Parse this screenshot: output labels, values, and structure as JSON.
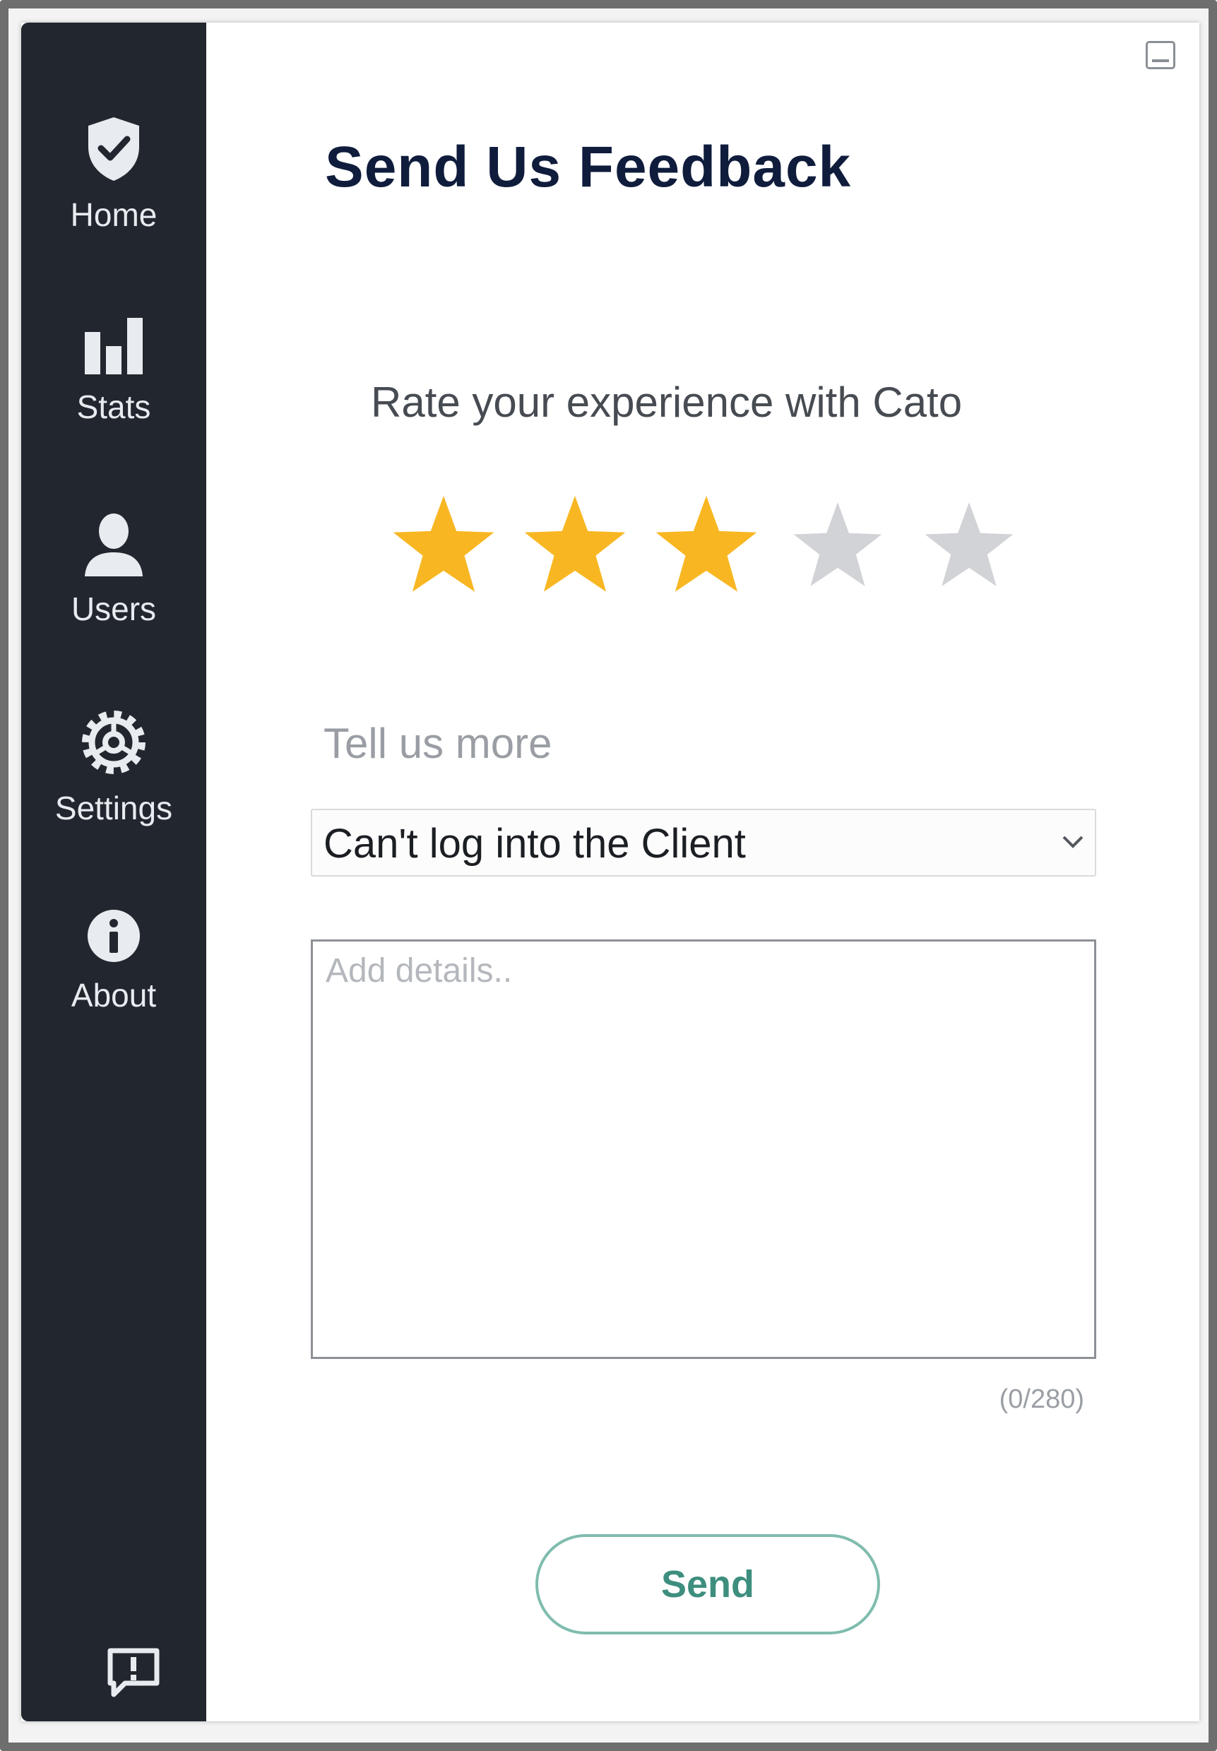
{
  "sidebar": {
    "items": [
      {
        "label": "Home",
        "icon": "shield-check-icon"
      },
      {
        "label": "Stats",
        "icon": "bar-chart-icon"
      },
      {
        "label": "Users",
        "icon": "user-icon"
      },
      {
        "label": "Settings",
        "icon": "gear-icon"
      },
      {
        "label": "About",
        "icon": "info-icon"
      }
    ],
    "feedback_icon": "feedback-alert-icon"
  },
  "page": {
    "title": "Send Us Feedback",
    "rate_label": "Rate your experience with Cato",
    "rating": {
      "value": 3,
      "max": 5
    },
    "more_label": "Tell us more",
    "topic_select": {
      "selected": "Can't log into the Client"
    },
    "details": {
      "placeholder": "Add details..",
      "counter": "(0/280)"
    },
    "send_label": "Send"
  },
  "colors": {
    "sidebar_bg": "#22272f",
    "star_filled": "#f8b722",
    "star_empty": "#d2d3d6",
    "title": "#0f1c3c",
    "send_accent": "#3e8e7e"
  }
}
